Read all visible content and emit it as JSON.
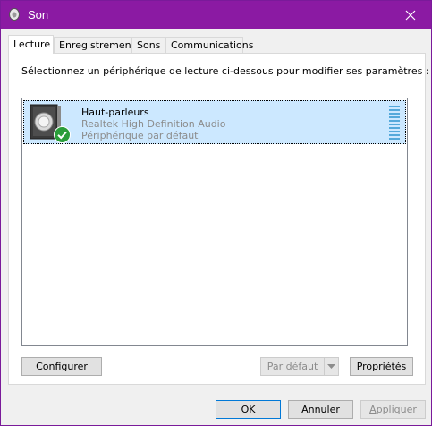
{
  "window": {
    "title": "Son",
    "close_glyph": "✕"
  },
  "tabs": [
    {
      "label": "Lecture",
      "active": true
    },
    {
      "label": "Enregistrement",
      "active": false
    },
    {
      "label": "Sons",
      "active": false
    },
    {
      "label": "Communications",
      "active": false
    }
  ],
  "panel": {
    "instruction": "Sélectionnez un périphérique de lecture ci-dessous pour modifier ses paramètres :",
    "device": {
      "name": "Haut-parleurs",
      "driver": "Realtek High Definition Audio",
      "state": "Périphérique par défaut",
      "icon": "speaker-icon",
      "status_icon": "default-check-icon",
      "level_bars": 10
    },
    "buttons": {
      "configure": {
        "pre": "",
        "key": "C",
        "post": "onfigurer"
      },
      "set_default": {
        "pre": "Par ",
        "key": "d",
        "post": "éfaut",
        "enabled": false
      },
      "properties": {
        "pre": "",
        "key": "P",
        "post": "ropriétés"
      }
    }
  },
  "footer": {
    "ok": "OK",
    "cancel": "Annuler",
    "apply": {
      "pre": "",
      "key": "A",
      "post": "ppliquer",
      "enabled": false
    }
  },
  "colors": {
    "titlebar": "#8b1aa3",
    "selection": "#cce8ff",
    "check": "#2a9d3a"
  }
}
